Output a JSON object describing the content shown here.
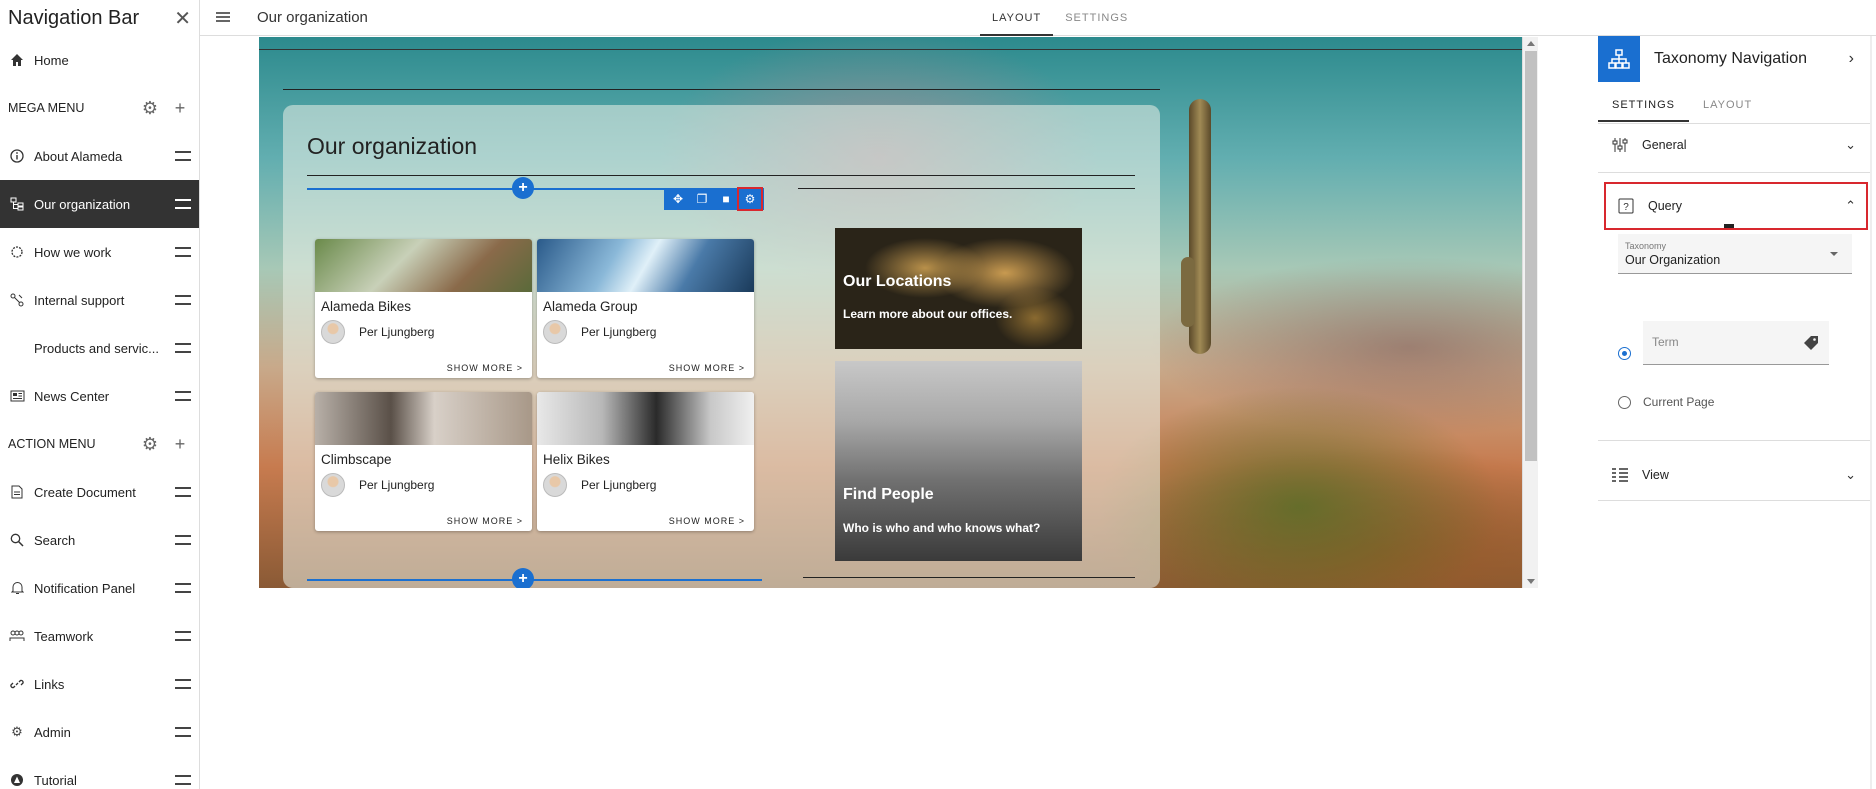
{
  "leftnav": {
    "title": "Navigation Bar",
    "close_icon": "close-icon",
    "home": "Home",
    "mega_menu": "MEGA MENU",
    "items_mega": [
      {
        "label": "About Alameda",
        "icon": "info-icon"
      },
      {
        "label": "Our organization",
        "icon": "org-icon"
      },
      {
        "label": "How we work",
        "icon": "gear-outline-icon"
      },
      {
        "label": "Internal support",
        "icon": "support-icon"
      },
      {
        "label": "Products and servic...",
        "icon": ""
      },
      {
        "label": "News Center",
        "icon": "news-icon"
      }
    ],
    "action_menu": "ACTION MENU",
    "items_action": [
      {
        "label": "Create Document",
        "icon": "document-icon"
      },
      {
        "label": "Search",
        "icon": "search-icon"
      },
      {
        "label": "Notification Panel",
        "icon": "bell-icon"
      },
      {
        "label": "Teamwork",
        "icon": "team-icon"
      },
      {
        "label": "Links",
        "icon": "link-icon"
      },
      {
        "label": "Admin",
        "icon": "gear-icon"
      },
      {
        "label": "Tutorial",
        "icon": "tutorial-icon"
      }
    ]
  },
  "topbar": {
    "page_title": "Our organization",
    "tabs": [
      "LAYOUT",
      "SETTINGS"
    ]
  },
  "canvas": {
    "org_title": "Our organization",
    "cards": [
      {
        "title": "Alameda Bikes",
        "person": "Per Ljungberg",
        "more": "SHOW MORE >"
      },
      {
        "title": "Alameda Group",
        "person": "Per Ljungberg",
        "more": "SHOW MORE >"
      },
      {
        "title": "Climbscape",
        "person": "Per Ljungberg",
        "more": "SHOW MORE >"
      },
      {
        "title": "Helix Bikes",
        "person": "Per Ljungberg",
        "more": "SHOW MORE >"
      }
    ],
    "promos": [
      {
        "title": "Our Locations",
        "subtitle": "Learn more about our offices."
      },
      {
        "title": "Find People",
        "subtitle": "Who is who and who knows what?"
      }
    ],
    "plus": "+"
  },
  "rpanel": {
    "title": "Taxonomy Navigation",
    "tabs": [
      "SETTINGS",
      "LAYOUT"
    ],
    "general": "General",
    "query": "Query",
    "taxonomy_label": "Taxonomy",
    "taxonomy_value": "Our Organization",
    "term_placeholder": "Term",
    "current_page": "Current Page",
    "view": "View"
  },
  "colors": {
    "accent": "#1a6fd0",
    "highlight": "#d8282e",
    "active_nav": "#333333"
  }
}
